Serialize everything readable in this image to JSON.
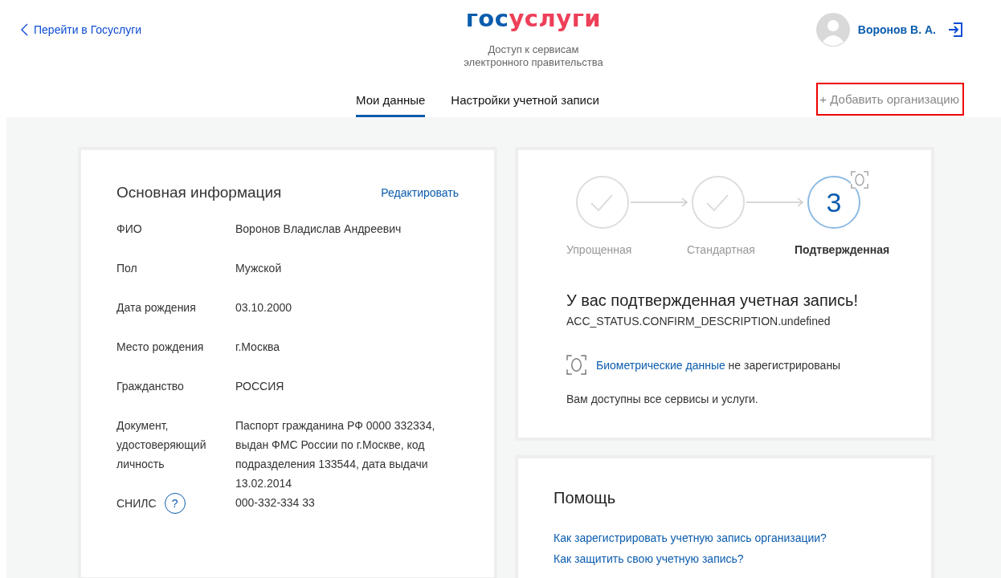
{
  "back_link": "Перейти в Госуслуги",
  "logo": {
    "first": "гос",
    "second": "услуги"
  },
  "tagline": [
    "Доступ к сервисам",
    "электронного правительства"
  ],
  "user": {
    "name": "Воронов В. А."
  },
  "tabs": [
    {
      "label": "Мои данные",
      "selected": true
    },
    {
      "label": "Настройки учетной записи",
      "selected": false
    }
  ],
  "add_org": {
    "label": "+ Добавить организацию",
    "highlighted": true
  },
  "main_info": {
    "title": "Основная информация",
    "edit": "Редактировать",
    "rows": [
      {
        "label": "ФИО",
        "value": "Воронов Владислав Андреевич"
      },
      {
        "label": "Пол",
        "value": "Мужской"
      },
      {
        "label": "Дата рождения",
        "value": "03.10.2000"
      },
      {
        "label": "Место рождения",
        "value": "г.Москва"
      },
      {
        "label": "Гражданство",
        "value": "РОССИЯ"
      },
      {
        "label": "Документ, удостоверяющий личность",
        "value": "Паспорт гражданина РФ 0000 332334, выдан ФМС России по г.Москве, код подразделения 133544, дата выдачи 13.02.2014"
      },
      {
        "label": "СНИЛС",
        "value": "000-332-334 33",
        "help_icon": "?"
      }
    ]
  },
  "status": {
    "steps": [
      {
        "kind": "done",
        "label": "Упрощенная",
        "selected": false
      },
      {
        "kind": "done",
        "label": "Стандартная",
        "selected": false
      },
      {
        "kind": "current",
        "number": "3",
        "label": "Подтвержденная",
        "selected": true
      }
    ],
    "title": "У вас подтвержденная учетная запись!",
    "description": "ACC_STATUS.CONFIRM_DESCRIPTION.undefined",
    "biometric_link": "Биометрические данные",
    "biometric_text": "не зарегистрированы",
    "note": "Вам доступны все сервисы и услуги."
  },
  "help": {
    "title": "Помощь",
    "links": [
      "Как зарегистрировать учетную запись организации?",
      "Как защитить свою учетную запись?"
    ]
  }
}
